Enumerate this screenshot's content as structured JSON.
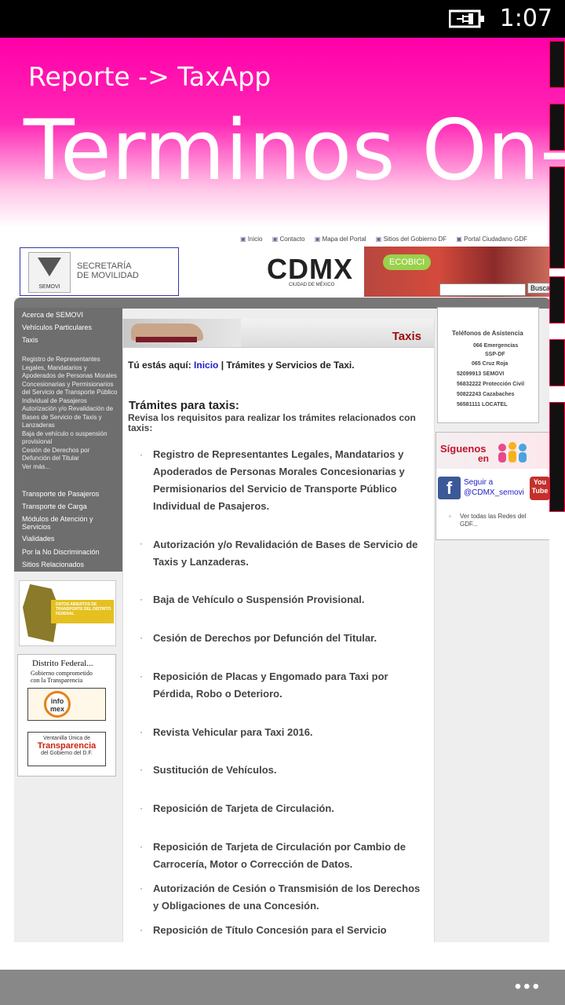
{
  "status": {
    "time": "1:07"
  },
  "app": {
    "subtitle": "Reporte -> TaxApp",
    "title": "Terminos On-L"
  },
  "web": {
    "toplinks": [
      "Inicio",
      "Contacto",
      "Mapa del Portal",
      "Sitios del Gobierno DF",
      "Portal Ciudadano GDF"
    ],
    "semovi": {
      "logo": "SEMOVI",
      "line1": "SECRETARÍA",
      "line2": "DE MOVILIDAD"
    },
    "cdmx": {
      "logo": "CDMX",
      "sub": "CIUDAD DE MÉXICO"
    },
    "ecobici": "ECOBICI",
    "search": {
      "button": "Buscar"
    },
    "nav": {
      "acerca": "Acerca de SEMOVI",
      "vehiculos": "Vehículos Particulares",
      "taxis": "Taxis",
      "taxis_sub": [
        "Registro de Representantes Legales, Mandatarios y Apoderados de Personas Morales Concesionarias y Permisionarios del Servicio de Transporte Público Individual de Pasajeros",
        "Autorización y/o Revalidación de Bases de Servicio de Taxis y Lanzaderas",
        "Baja de vehículo o suspensión provisional",
        "Cesión de Derechos por Defunción del Titular",
        "Ver más..."
      ],
      "pasajeros": "Transporte de Pasajeros",
      "carga": "Transporte de Carga",
      "modulos": "Módulos de Atención y Servicios",
      "vialidades": "Vialidades",
      "discriminacion": "Por la No Discriminación",
      "relacionados": "Sitios Relacionados"
    },
    "banners": {
      "datos_abiertos": "DATOS ABIERTOS DE TRANSPORTE DEL DISTRITO FEDERAL",
      "df_title": "Distrito Federal...",
      "df_sub1": "Gobierno comprometido",
      "df_sub2": "con la Transparencia",
      "infomex": "info mex",
      "vent_a": "Ventanilla Única de",
      "vent_b": "Transparencia",
      "vent_c": "del Gobierno del D.F."
    },
    "content": {
      "section_title": "Taxis",
      "breadcrumb_prefix": "Tú estás aquí:",
      "breadcrumb_link": "Inicio",
      "breadcrumb_rest": " | Trámites y Servicios de Taxi.",
      "heading": "Trámites para taxis:",
      "intro": "Revisa los requisitos para realizar los trámites relacionados con taxis:",
      "bullet": "·",
      "requirements": [
        "Registro de Representantes Legales, Mandatarios y Apoderados de Personas Morales Concesionarias y Permisionarios del Servicio de Transporte Público Individual de Pasajeros.",
        "Autorización y/o Revalidación de Bases de Servicio de Taxis y Lanzaderas.",
        "Baja de Vehículo o Suspensión Provisional.",
        "Cesión de Derechos por Defunción del Titular.",
        "Reposición de Placas y Engomado para Taxi por Pérdida, Robo o Deterioro.",
        "Revista Vehicular para Taxi 2016.",
        "Sustitución de Vehículos.",
        "Reposición de Tarjeta de Circulación.",
        "Reposición de Tarjeta de Circulación por Cambio de Carrocería, Motor o Corrección de Datos.",
        "Autorización de Cesión o Transmisión de los Derechos y Obligaciones de una Concesión.",
        "Reposición de Título Concesión para el Servicio"
      ]
    },
    "phones": {
      "title": "Teléfonos de Asistencia",
      "rows": [
        {
          "num": "066",
          "label": "Emergencias"
        },
        {
          "num": "",
          "label": "SSP-DF"
        },
        {
          "num": "065",
          "label": "Cruz Roja"
        },
        {
          "num": "52099913",
          "label": "SEMOVI"
        },
        {
          "num": "56832222",
          "label": "Protección Civil"
        },
        {
          "num": "50822243",
          "label": "Cazabaches"
        },
        {
          "num": "56581111",
          "label": "LOCATEL"
        }
      ]
    },
    "social": {
      "siguenos": "Síguenos",
      "en": "en",
      "follow1": "Seguir a",
      "follow2": "@CDMX_semovi",
      "youtube": "You Tube",
      "all": "Ver todas las Redes del GDF..."
    }
  },
  "appbar": {
    "more": "•••"
  },
  "colors": {
    "accent": "#ff00a8",
    "link": "#1e20c6",
    "section_title": "#9a0d0d"
  }
}
